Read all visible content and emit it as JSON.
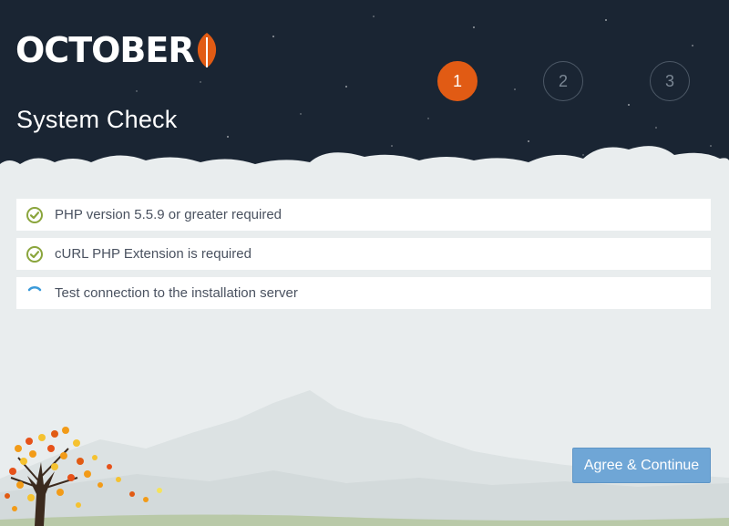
{
  "app": {
    "logo_text": "OCTOBER",
    "page_title": "System Check"
  },
  "steps": [
    {
      "label": "1",
      "active": true
    },
    {
      "label": "2",
      "active": false
    },
    {
      "label": "3",
      "active": false
    }
  ],
  "checks": [
    {
      "label": "PHP version 5.5.9 or greater required",
      "status": "passed",
      "icon": "check-circle-icon"
    },
    {
      "label": "cURL PHP Extension is required",
      "status": "passed",
      "icon": "check-circle-icon"
    },
    {
      "label": "Test connection to the installation server",
      "status": "loading",
      "icon": "spinner-icon"
    }
  ],
  "actions": {
    "continue_label": "Agree & Continue"
  },
  "colors": {
    "header_bg": "#1a2533",
    "accent": "#e15b14",
    "success": "#8aa53c",
    "spinner": "#3a9ad9",
    "button": "#6fa6d6",
    "body_bg": "#e9edee"
  }
}
